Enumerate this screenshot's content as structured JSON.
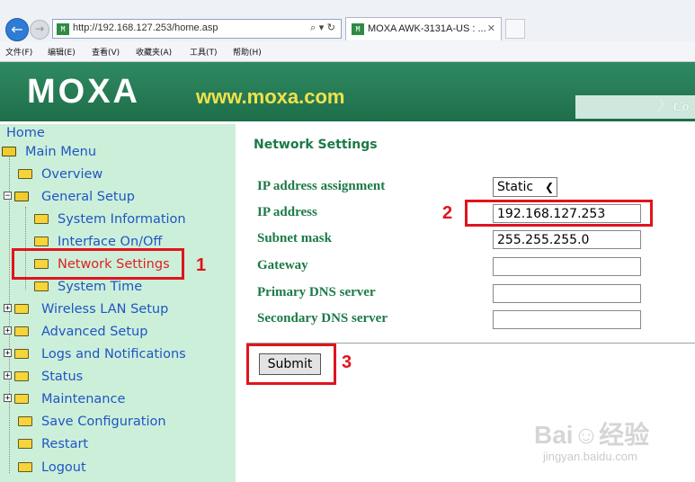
{
  "browser": {
    "url": "http://192.168.127.253/home.asp",
    "address_tools": "⌕ ▾ ↻",
    "tab_title": "MOXA AWK-3131A-US : ...",
    "tab_close": "✕",
    "favicon_text": "M",
    "menu": [
      "文件(F)",
      "编辑(E)",
      "查看(V)",
      "收藏夹(A)",
      "工具(T)",
      "帮助(H)"
    ]
  },
  "header": {
    "logo": "MOXA",
    "url": "www.moxa.com",
    "right_text": "》 Co"
  },
  "nav": {
    "home": "Home",
    "main_menu": "Main Menu",
    "overview": "Overview",
    "general_setup": "General Setup",
    "system_information": "System Information",
    "interface_on_off": "Interface On/Off",
    "network_settings": "Network Settings",
    "system_time": "System Time",
    "wireless_lan_setup": "Wireless LAN Setup",
    "advanced_setup": "Advanced Setup",
    "logs_notifications": "Logs and Notifications",
    "status": "Status",
    "maintenance": "Maintenance",
    "save_configuration": "Save Configuration",
    "restart": "Restart",
    "logout": "Logout"
  },
  "form": {
    "title": "Network Settings",
    "labels": {
      "ip_assignment": "IP address assignment",
      "ip_address": "IP address",
      "subnet_mask": "Subnet mask",
      "gateway": "Gateway",
      "primary_dns": "Primary DNS server",
      "secondary_dns": "Secondary DNS server"
    },
    "ip_assignment_value": "Static",
    "ip_address_value": "192.168.127.253",
    "subnet_mask_value": "255.255.255.0",
    "gateway_value": "",
    "primary_dns_value": "",
    "secondary_dns_value": "",
    "submit_label": "Submit"
  },
  "annotations": {
    "step1": "1",
    "step2": "2",
    "step3": "3",
    "color": "#e0141e"
  },
  "watermark": {
    "logo": "Bai☺经验",
    "sub": "jingyan.baidu.com"
  },
  "colors": {
    "banner": "#1e6e4a",
    "nav_bg": "#ccefd9",
    "nav_link": "#1f56c4",
    "label_green": "#1b7a46",
    "active_red": "#e02020"
  }
}
